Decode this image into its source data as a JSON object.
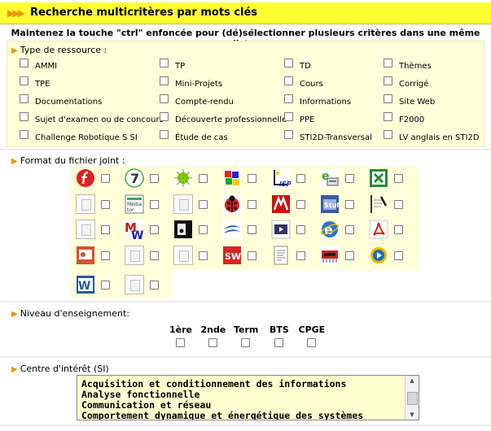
{
  "header": {
    "title": "Recherche multicritères par mots clés",
    "arrows": "▶▶▶"
  },
  "instructions": "Maintenez la touche \"ctrl\" enfoncée pour (dé)sélectionner plusieurs critères dans une même liste.",
  "ressource": {
    "label": "Type de ressource :",
    "items": [
      "AMMI",
      "TP",
      "TD",
      "Thèmes",
      "TPE",
      "Mini-Projets",
      "Cours",
      "Corrigé",
      "Documentations",
      "Compte-rendu",
      "Informations",
      "Site Web",
      "Sujet d'examen ou de concours",
      "Découverte professionnelle",
      "PPE",
      "F2000",
      "Challenge Robotique S SI",
      "Étude de cas",
      "STI2D-Transversal",
      "LV anglais en STI2D"
    ]
  },
  "format": {
    "label": "Format du fichier joint :",
    "icons": [
      "flash-icon",
      "seven-zip-icon",
      "sparkle-icon",
      "paint-icon",
      "isp-icon",
      "executable-icon",
      "excel-icon",
      "image-placeholder-icon",
      "media-player-icon",
      "image-placeholder-icon",
      "ladybug-icon",
      "microchip-icon",
      "archive-icon",
      "notepad-icon",
      "image-placeholder-icon",
      "mathcad-icon",
      "audio-icon",
      "openoffice-icon",
      "video-icon",
      "internet-explorer-icon",
      "pdf-icon",
      "powerpoint-icon",
      "image-placeholder-icon",
      "image-placeholder-icon",
      "solidworks-icon",
      "text-document-icon",
      "circuit-icon",
      "quicktime-icon",
      "word-icon",
      "image-placeholder-icon"
    ]
  },
  "niveau": {
    "label": "Niveau d'enseignement:",
    "options": [
      "1ère",
      "2nde",
      "Term",
      "BTS",
      "CPGE"
    ]
  },
  "centre": {
    "label": "Centre d'intérêt (SI)",
    "options": [
      "Acquisition et conditionnement des informations",
      "Analyse fonctionnelle",
      "Communication et réseau",
      "Comportement dynamique et énergétique des systèmes"
    ]
  }
}
